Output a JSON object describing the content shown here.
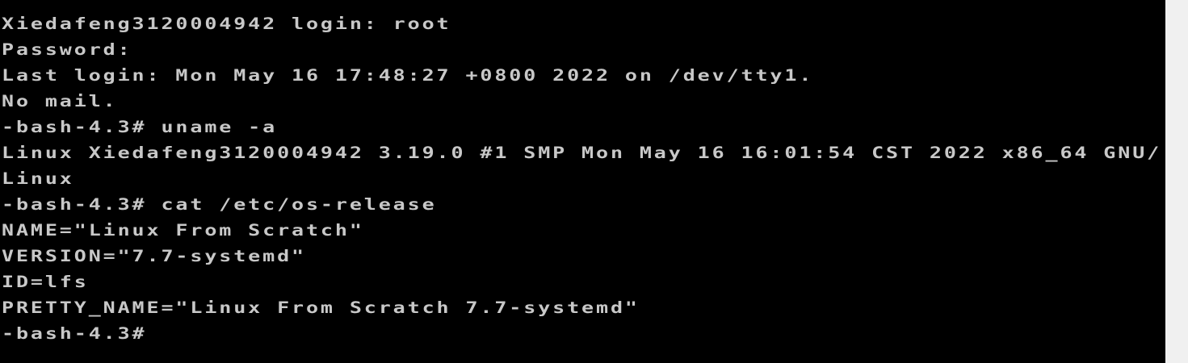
{
  "console": {
    "lines": [
      "Xiedafeng3120004942 login: root",
      "Password:",
      "Last login: Mon May 16 17:48:27 +0800 2022 on /dev/tty1.",
      "No mail.",
      "-bash-4.3# uname -a",
      "Linux Xiedafeng3120004942 3.19.0 #1 SMP Mon May 16 16:01:54 CST 2022 x86_64 GNU/",
      "Linux",
      "-bash-4.3# cat /etc/os-release",
      "NAME=\"Linux From Scratch\"",
      "VERSION=\"7.7-systemd\"",
      "ID=lfs",
      "PRETTY_NAME=\"Linux From Scratch 7.7-systemd\"",
      "-bash-4.3#"
    ]
  },
  "colors": {
    "background": "#000000",
    "text": "#c8c8c8",
    "outside": "#f0f0f0"
  }
}
